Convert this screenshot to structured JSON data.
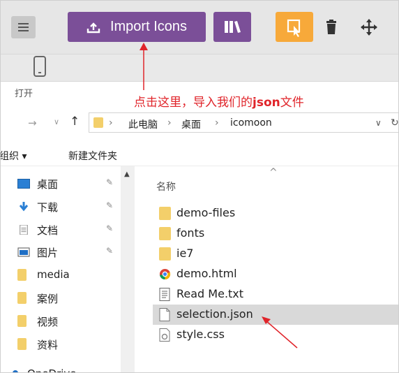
{
  "toolbar": {
    "import_label": "Import Icons"
  },
  "dialog": {
    "open_label": "打开",
    "breadcrumb": [
      "此电脑",
      "桌面",
      "icomoon"
    ],
    "commands": {
      "organize": "组织 ▾",
      "new_folder": "新建文件夹"
    },
    "column_name": "名称"
  },
  "annotation": {
    "text_part1": "点击这里，导入我们的",
    "text_bold": "json",
    "text_part2": "文件",
    "color": "#e0242a"
  },
  "sidebar": {
    "items": [
      {
        "label": "桌面",
        "icon": "desktop-icon",
        "pinned": true
      },
      {
        "label": "下载",
        "icon": "download-icon",
        "pinned": true
      },
      {
        "label": "文档",
        "icon": "document-icon",
        "pinned": true
      },
      {
        "label": "图片",
        "icon": "picture-icon",
        "pinned": true
      },
      {
        "label": "media",
        "icon": "folder-icon",
        "pinned": false
      },
      {
        "label": "案例",
        "icon": "folder-icon",
        "pinned": false
      },
      {
        "label": "视频",
        "icon": "folder-icon",
        "pinned": false
      },
      {
        "label": "资料",
        "icon": "folder-icon",
        "pinned": false
      },
      {
        "label": "OneDrive",
        "icon": "cloud-icon",
        "pinned": false
      }
    ]
  },
  "files": [
    {
      "name": "demo-files",
      "icon": "folder-icon"
    },
    {
      "name": "fonts",
      "icon": "folder-icon"
    },
    {
      "name": "ie7",
      "icon": "folder-icon"
    },
    {
      "name": "demo.html",
      "icon": "chrome-icon"
    },
    {
      "name": "Read Me.txt",
      "icon": "text-file-icon"
    },
    {
      "name": "selection.json",
      "icon": "file-icon",
      "selected": true
    },
    {
      "name": "style.css",
      "icon": "css-file-icon"
    }
  ],
  "colors": {
    "accent_purple": "#7b4f98",
    "accent_orange": "#f7a93a",
    "folder": "#f3cf6a"
  }
}
